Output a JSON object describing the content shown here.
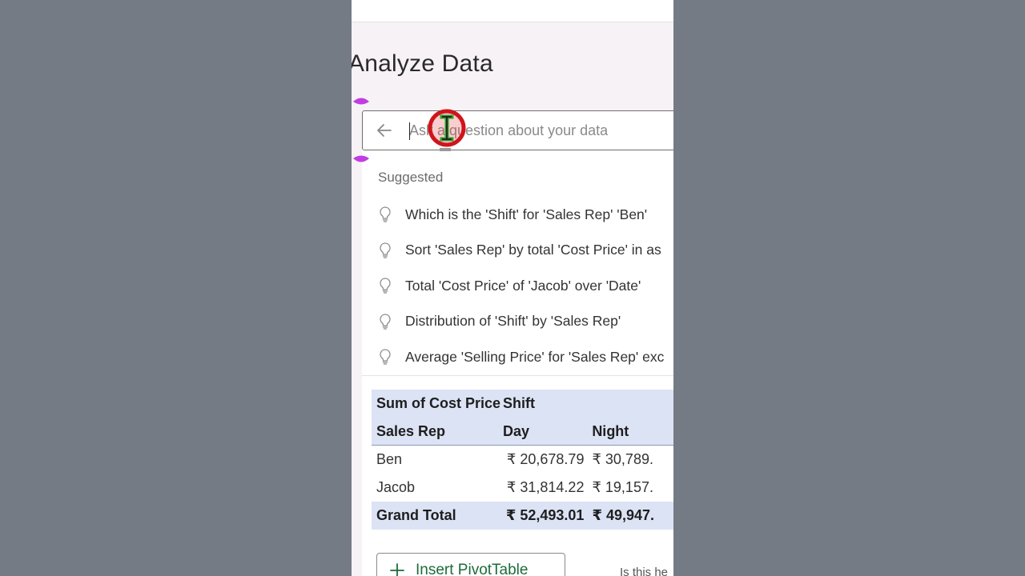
{
  "pane": {
    "title": "Analyze Data"
  },
  "search": {
    "placeholder": "Ask a question about your data"
  },
  "suggestions": {
    "label": "Suggested",
    "items": [
      "Which is the 'Shift' for 'Sales Rep' 'Ben'",
      "Sort 'Sales Rep' by total 'Cost Price' in as",
      "Total 'Cost Price' of 'Jacob' over 'Date'",
      "Distribution of 'Shift' by 'Sales Rep'",
      "Average 'Selling Price' for 'Sales Rep' exc"
    ]
  },
  "pivot": {
    "header1": {
      "measure": "Sum of Cost Price",
      "column_field": "Shift"
    },
    "header2": {
      "row_field": "Sales Rep",
      "col1": "Day",
      "col2": "Night"
    },
    "rows": [
      {
        "name": "Ben",
        "day": "₹ 20,678.79",
        "night": "₹ 30,789."
      },
      {
        "name": "Jacob",
        "day": "₹ 31,814.22",
        "night": "₹ 19,157."
      }
    ],
    "total": {
      "name": "Grand Total",
      "day": "₹ 52,493.01",
      "night": "₹ 49,947."
    }
  },
  "actions": {
    "insert_pivot_label": "Insert PivotTable",
    "feedback_text": "Is this he"
  },
  "colors": {
    "outer_background": "#757b84",
    "pane_background": "#f7f2f6",
    "pivot_header": "#dce3f5",
    "accent_green": "#1d6b3a",
    "selection_handle": "#c23ce3",
    "cursor_ring": "#d0141b"
  },
  "icons": {
    "back": "arrow-left-icon",
    "suggestion": "lightbulb-icon",
    "insert": "plus-icon",
    "cursor": "text-cursor-icon"
  }
}
